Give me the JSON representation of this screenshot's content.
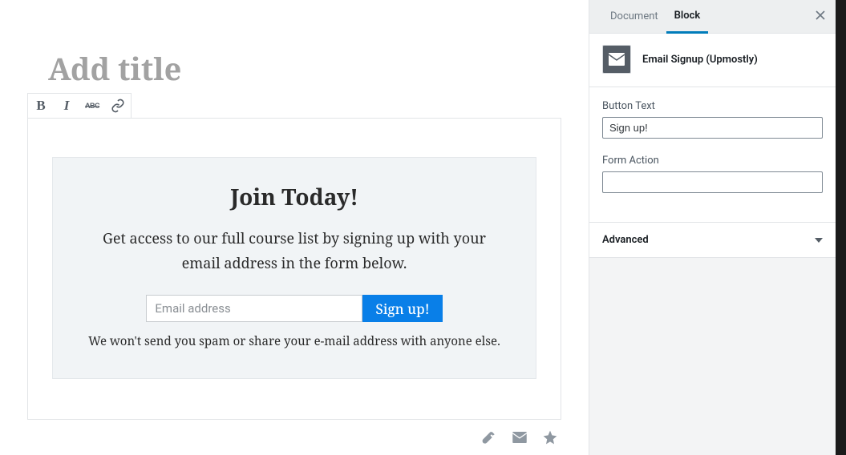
{
  "editor": {
    "title_placeholder": "Add title",
    "toolbar": {
      "bold": "B",
      "italic": "I",
      "strike": "ABC"
    },
    "signup_block": {
      "heading": "Join Today!",
      "subtext": "Get access to our full course list by signing up with your email address in the form below.",
      "email_placeholder": "Email address",
      "button_label": "Sign up!",
      "note": "We won't send you spam or share your e-mail address with anyone else."
    }
  },
  "sidebar": {
    "tabs": {
      "document": "Document",
      "block": "Block"
    },
    "block_title": "Email Signup (Upmostly)",
    "fields": {
      "button_text_label": "Button Text",
      "button_text_value": "Sign up!",
      "form_action_label": "Form Action",
      "form_action_value": ""
    },
    "advanced_label": "Advanced"
  }
}
